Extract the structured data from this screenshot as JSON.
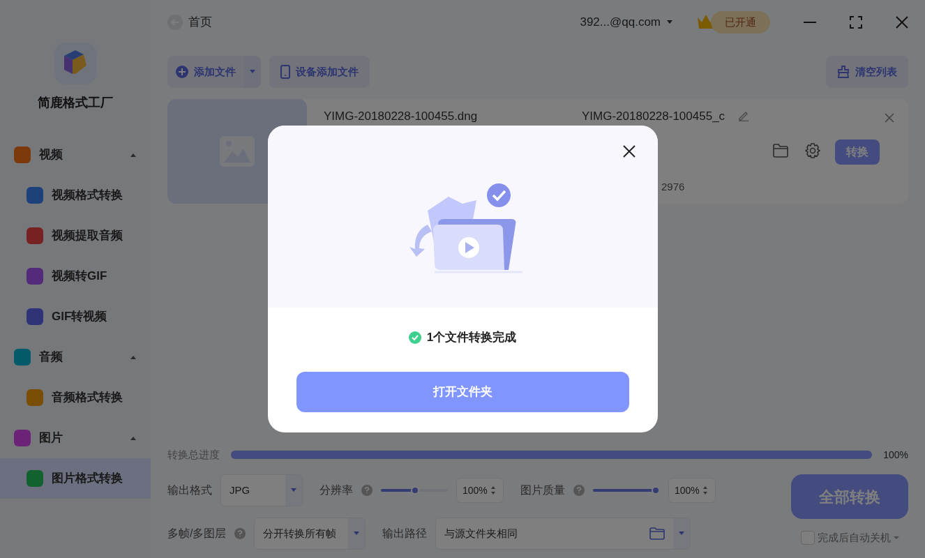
{
  "sidebar": {
    "app_name": "简鹿格式工厂",
    "groups": [
      {
        "label": "视频",
        "expanded": true,
        "items": [
          {
            "label": "视频格式转换",
            "selected": false
          },
          {
            "label": "视频提取音频",
            "selected": false
          },
          {
            "label": "视频转GIF",
            "selected": false
          },
          {
            "label": "GIF转视频",
            "selected": false
          }
        ]
      },
      {
        "label": "音频",
        "expanded": true,
        "items": [
          {
            "label": "音频格式转换",
            "selected": false
          }
        ]
      },
      {
        "label": "图片",
        "expanded": true,
        "items": [
          {
            "label": "图片格式转换",
            "selected": true
          }
        ]
      }
    ]
  },
  "header": {
    "back_label": "首页",
    "account": "392...@qq.com",
    "vip_badge": "已开通"
  },
  "toolbar": {
    "add_file": "添加文件",
    "device_add": "设备添加文件",
    "clear_list": "清空列表"
  },
  "files": [
    {
      "name": "YIMG-20180228-100455.dng",
      "output_name": "YIMG-20180228-100455_c",
      "detail": "2976",
      "convert": "转换"
    }
  ],
  "progress": {
    "label": "转换总进度",
    "level": 1,
    "reading": "100%"
  },
  "settings": {
    "output_format": {
      "label": "输出格式",
      "value": "JPG"
    },
    "resolution": {
      "label": "分辨率",
      "level": 0.51,
      "value": "100%"
    },
    "quality": {
      "label": "图片质量",
      "level": 1,
      "value": "100%"
    },
    "frames": {
      "label": "多帧/多图层",
      "value": "分开转换所有帧"
    },
    "output_path": {
      "label": "输出路径",
      "value": "与源文件夹相同"
    }
  },
  "convert_all": "全部转换",
  "auto_shutdown": {
    "label": "完成后自动关机",
    "checked": false
  },
  "dialog": {
    "message": "1个文件转换完成",
    "button": "打开文件夹"
  }
}
